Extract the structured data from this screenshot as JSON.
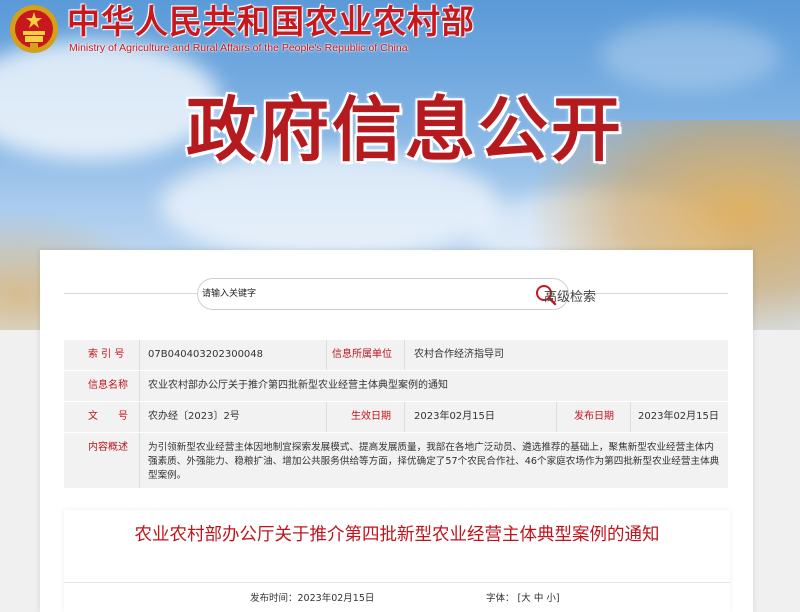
{
  "header": {
    "site_title": "中华人民共和国农业农村部",
    "site_subtitle": "Ministry of Agriculture and Rural Affairs of the People's Republic of China",
    "hero_title": "政府信息公开"
  },
  "search": {
    "placeholder": "请输入关键字",
    "advanced_label": "高级检索"
  },
  "meta": {
    "index_label": "索 引 号",
    "index_value": "07B040403202300048",
    "dept_label": "信息所属单位",
    "dept_value": "农村合作经济指导司",
    "name_label": "信息名称",
    "name_value": "农业农村部办公厅关于推介第四批新型农业经营主体典型案例的通知",
    "doc_label": "文　　号",
    "doc_value": "农办经〔2023〕2号",
    "effective_label": "生效日期",
    "effective_value": "2023年02月15日",
    "publish_label": "发布日期",
    "publish_value": "2023年02月15日",
    "summary_label": "内容概述",
    "summary_value": "为引领新型农业经营主体因地制宜探索发展模式、提高发展质量，我部在各地广泛动员、遴选推荐的基础上，聚焦新型农业经营主体内强素质、外强能力、稳粮扩油、增加公共服务供给等方面，择优确定了57个农民合作社、46个家庭农场作为第四批新型农业经营主体典型案例。"
  },
  "article": {
    "title": "农业农村部办公厅关于推介第四批新型农业经营主体典型案例的通知",
    "pub_label": "发布时间：",
    "pub_value": "2023年02月15日",
    "font_label": "字体：",
    "font_open": "[",
    "font_large": "大",
    "font_medium": "中",
    "font_small": "小",
    "font_close": "]"
  },
  "colors": {
    "brand_red": "#c9171e",
    "label_red": "#c0141c"
  }
}
